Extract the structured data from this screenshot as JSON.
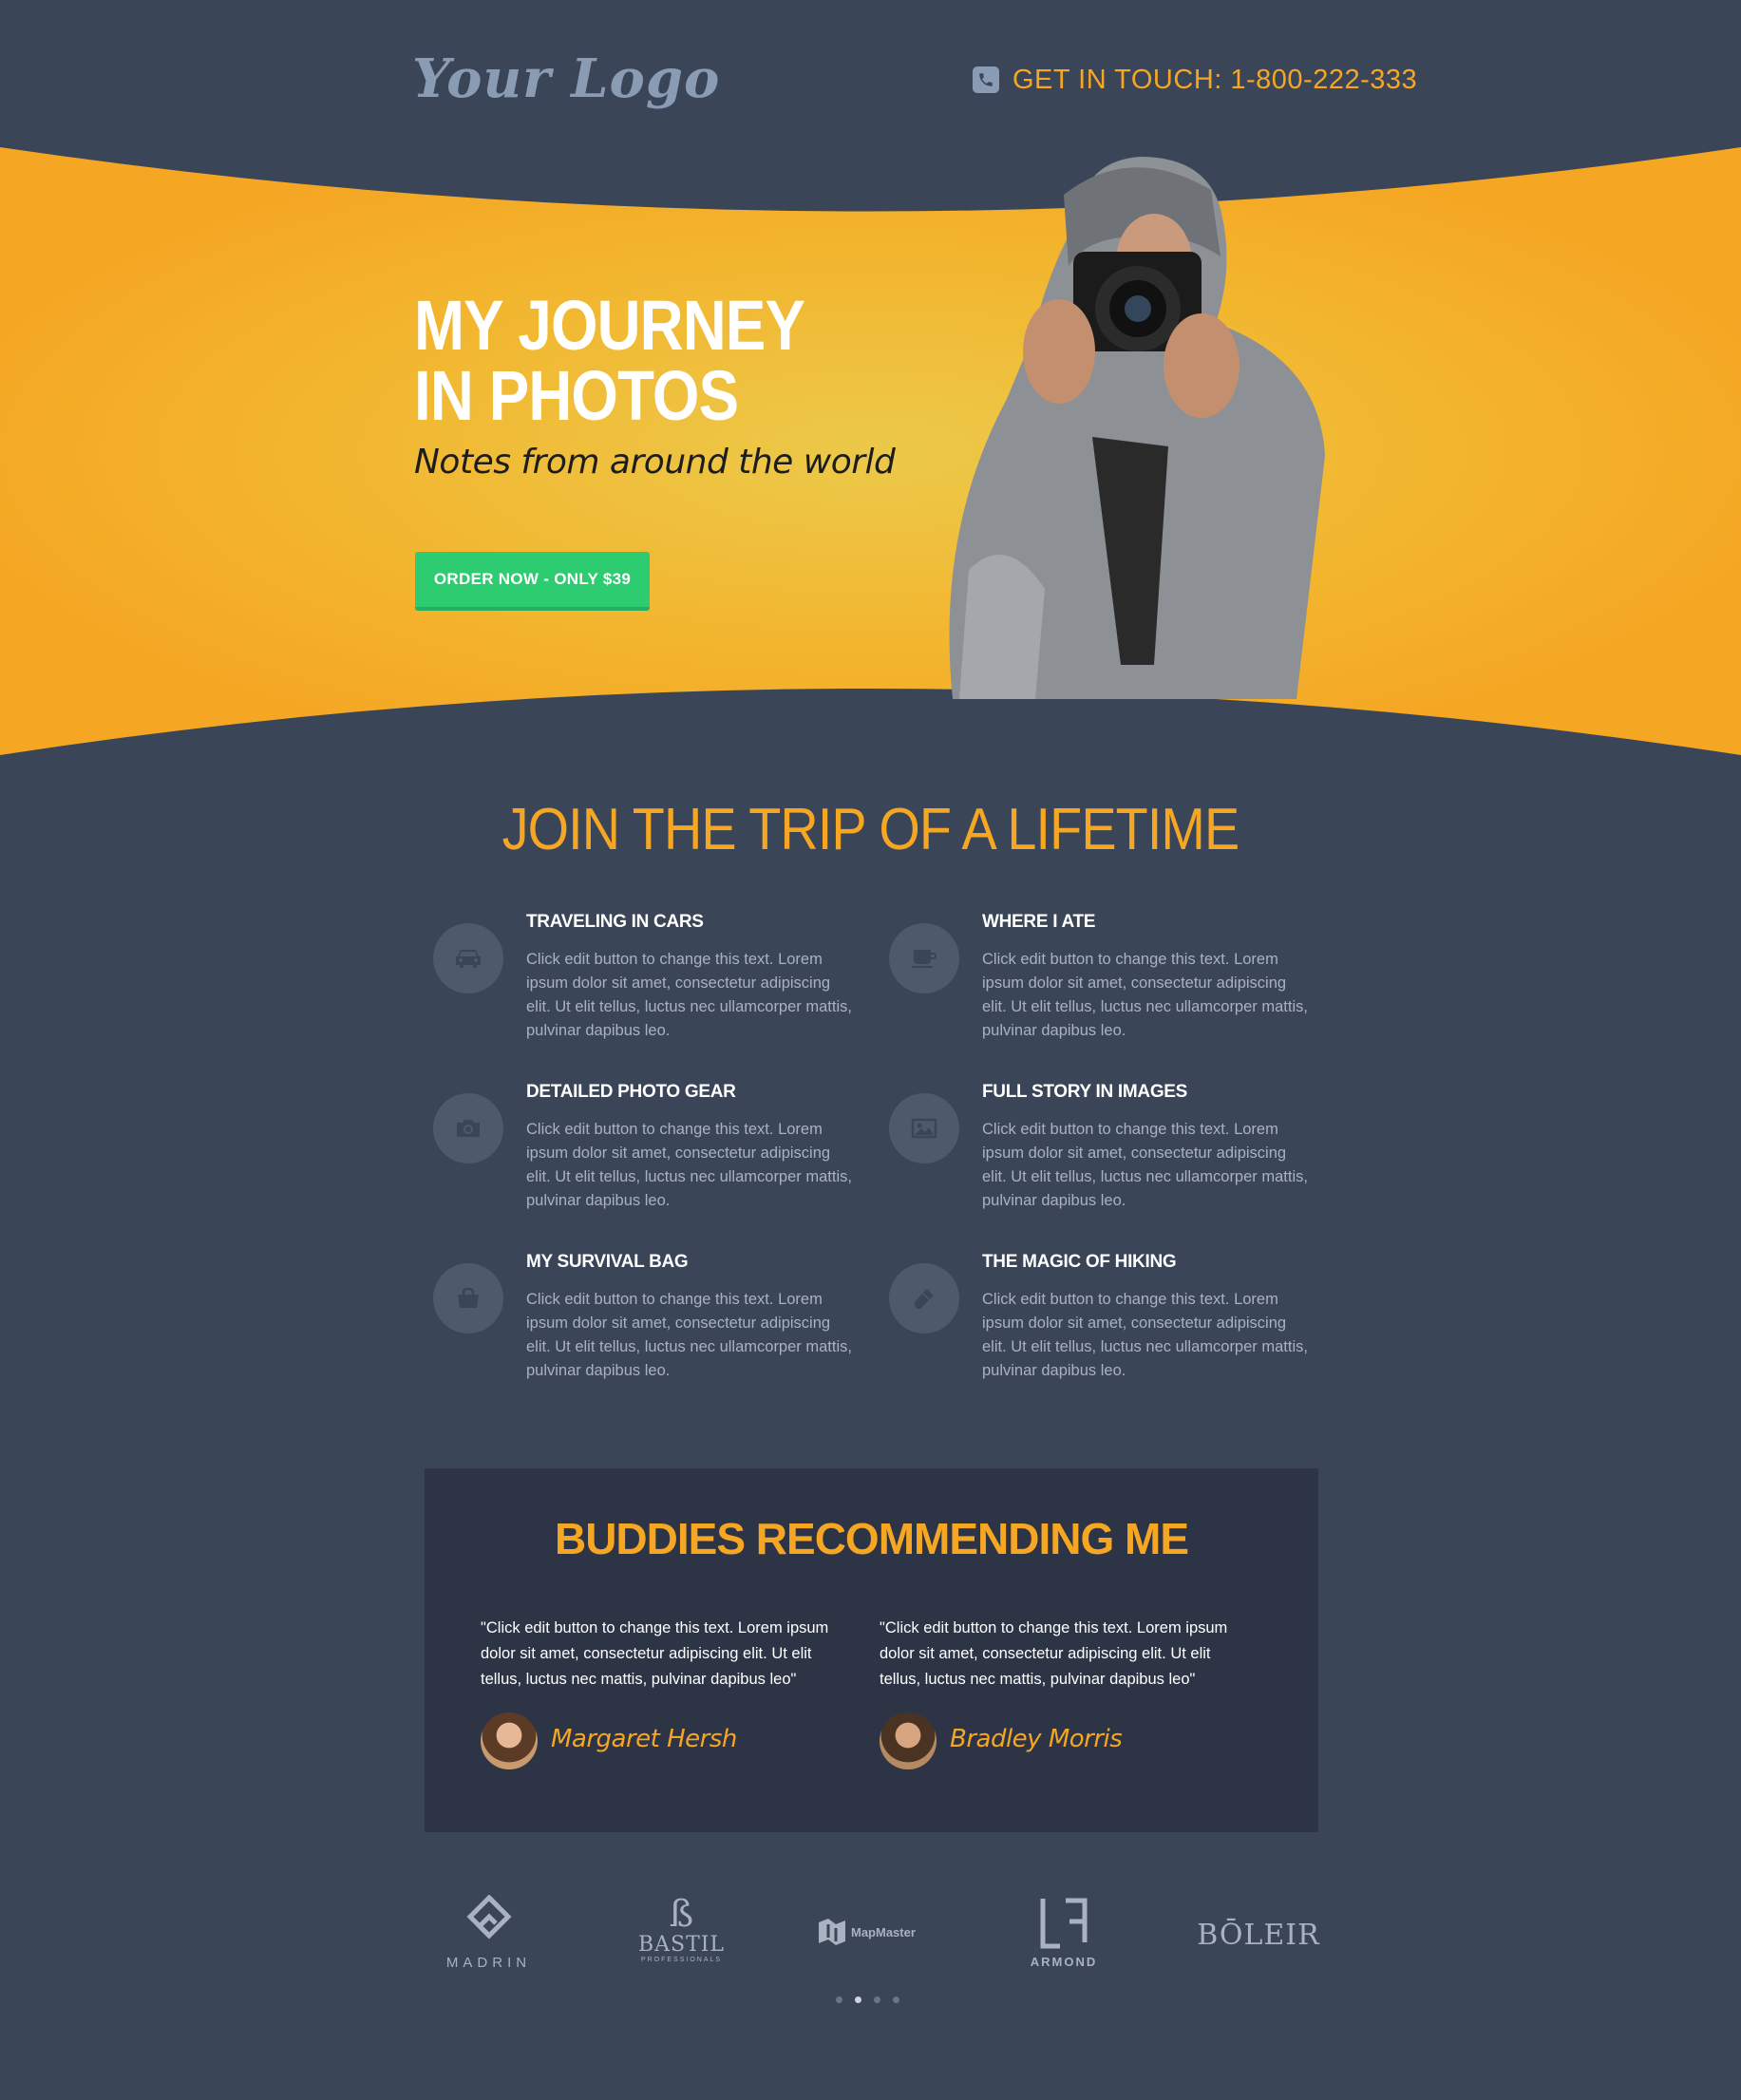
{
  "header": {
    "logo_text": "Your Logo",
    "contact_text": "GET IN TOUCH: 1-800-222-333",
    "phone_icon": "phone-icon"
  },
  "hero": {
    "title": "MY JOURNEY IN PHOTOS",
    "subtitle": "Notes from around the world",
    "cta_label": "ORDER NOW - ONLY $39"
  },
  "features": {
    "title": "JOIN THE TRIP OF A LIFETIME",
    "items": [
      {
        "title": "TRAVELING IN CARS",
        "icon": "car-icon",
        "body": "Click edit button to change this text. Lorem ipsum dolor sit amet, consectetur adipiscing elit. Ut elit tellus, luctus nec ullamcorper mattis, pulvinar dapibus leo."
      },
      {
        "title": "WHERE I ATE",
        "icon": "coffee-cup-icon",
        "body": "Click edit button to change this text. Lorem ipsum dolor sit amet, consectetur adipiscing elit. Ut elit tellus, luctus nec ullamcorper mattis, pulvinar dapibus leo."
      },
      {
        "title": "DETAILED PHOTO GEAR",
        "icon": "camera-icon",
        "body": "Click edit button to change this text. Lorem ipsum dolor sit amet, consectetur adipiscing elit. Ut elit tellus, luctus nec ullamcorper mattis, pulvinar dapibus leo."
      },
      {
        "title": "FULL STORY IN IMAGES",
        "icon": "image-icon",
        "body": "Click edit button to change this text. Lorem ipsum dolor sit amet, consectetur adipiscing elit. Ut elit tellus, luctus nec ullamcorper mattis, pulvinar dapibus leo."
      },
      {
        "title": "MY SURVIVAL BAG",
        "icon": "shopping-bag-icon",
        "body": "Click edit button to change this text. Lorem ipsum dolor sit amet, consectetur adipiscing elit. Ut elit tellus, luctus nec ullamcorper mattis, pulvinar dapibus leo."
      },
      {
        "title": "THE MAGIC OF HIKING",
        "icon": "flashlight-icon",
        "body": "Click edit button to change this text. Lorem ipsum dolor sit amet, consectetur adipiscing elit. Ut elit tellus, luctus nec ullamcorper mattis, pulvinar dapibus leo."
      }
    ]
  },
  "testimonials": {
    "title": "BUDDIES RECOMMENDING ME",
    "items": [
      {
        "quote": "\"Click edit button to change this text. Lorem ipsum dolor sit amet, consectetur adipiscing elit. Ut elit tellus, luctus nec mattis, pulvinar dapibus leo\"",
        "name": "Margaret Hersh"
      },
      {
        "quote": "\"Click edit button to change this text. Lorem ipsum dolor sit amet, consectetur adipiscing elit. Ut elit tellus, luctus nec mattis, pulvinar dapibus leo\"",
        "name": "Bradley Morris"
      }
    ]
  },
  "brands": {
    "items": [
      {
        "name": "MADRIN"
      },
      {
        "name": "BASTIL",
        "tagline": "PROFESSIONALS"
      },
      {
        "name": "MapMaster"
      },
      {
        "name": "ARMOND"
      },
      {
        "name": "BŌLEIR"
      }
    ],
    "carousel_pages": 4,
    "carousel_active": 2
  },
  "colors": {
    "background": "#3b4558",
    "accent": "#f5a623",
    "cta": "#2ecc71",
    "panel": "#2d3446"
  }
}
